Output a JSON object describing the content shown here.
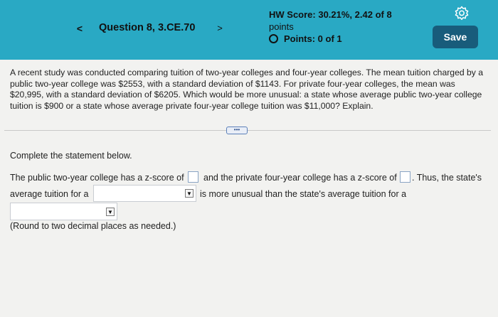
{
  "header": {
    "nav_prev": "<",
    "question_title": "Question 8, 3.CE.70",
    "nav_next": ">",
    "hw_score_label": "HW Score: 30.21%, 2.42 of 8",
    "hw_score_suffix": "points",
    "points_label": "Points: 0 of 1",
    "save_label": "Save",
    "settings_icon": "gear-icon",
    "accent_color": "#29a9c4",
    "save_color": "#185c7b"
  },
  "problem": {
    "text": "A recent study was conducted comparing tuition of two-year colleges and four-year colleges. The mean tuition charged by a public two-year college was $2553, with a standard deviation of $1143. For private four-year colleges, the mean was $20,995, with a standard deviation of $6205. Which would be more unusual: a state whose average public two-year college tuition is $900 or a state whose average private four-year college tuition was $11,000? Explain."
  },
  "more_button": "•••",
  "answer": {
    "instruction": "Complete the statement below.",
    "part1": "The public two-year college has a z-score of",
    "part2": "and the private four-year college has a z-score of",
    "part3": ". Thus, the state's",
    "part4": "average tuition for a",
    "part5": "is more unusual than the state's average tuition for a",
    "z_score_public": "",
    "z_score_private": "",
    "dropdown1_value": "",
    "dropdown2_value": "",
    "dropdown_arrow": "▼",
    "note": "(Round to two decimal places as needed.)"
  }
}
